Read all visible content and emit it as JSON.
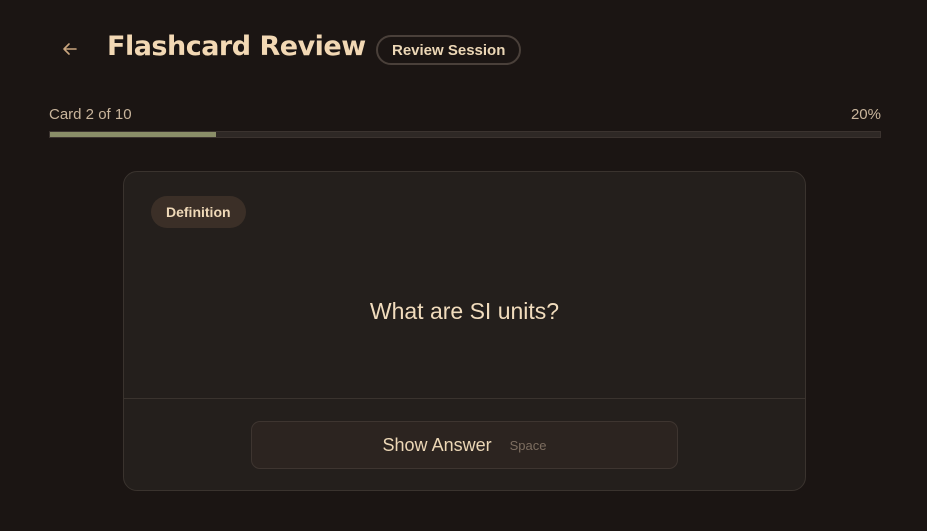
{
  "header": {
    "title": "Flashcard Review",
    "badge": "Review Session",
    "back_icon": "arrow-left-icon"
  },
  "progress": {
    "label": "Card 2 of 10",
    "percent_text": "20%",
    "fraction": 0.2
  },
  "card": {
    "tag": "Definition",
    "question": "What are SI units?"
  },
  "actions": {
    "show_answer_label": "Show Answer",
    "shortcut": "Space"
  },
  "colors": {
    "background": "#1b1513",
    "accent_text": "#f2d8b4",
    "progress_fill": "#8a8e68",
    "card_bg": "#241f1c"
  }
}
